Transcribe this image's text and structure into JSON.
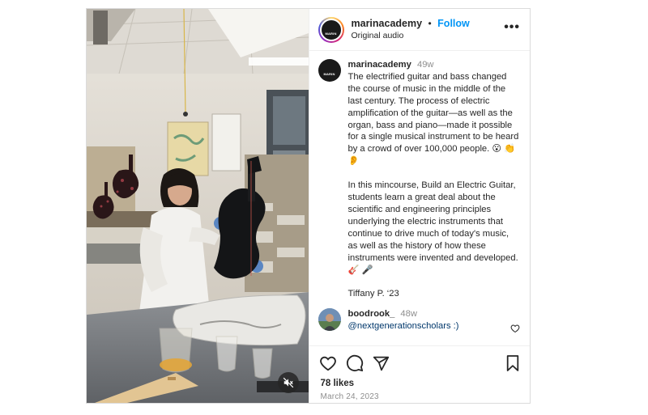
{
  "header": {
    "username": "marinacademy",
    "separator": "•",
    "follow_label": "Follow",
    "audio": "Original audio",
    "more_label": "•••",
    "avatar_text": "MARIN"
  },
  "caption": {
    "username": "marinacademy",
    "time": "49w",
    "paragraph1": "The electrified guitar and bass changed the course of music in the middle of the last century.  The process of electric amplification of the guitar—as well as the organ, bass and piano—made it possible for a single musical instrument to be heard by a crowd of over 100,000 people.  😮 👏 👂",
    "paragraph2": "In this mincourse, Build an Electric Guitar, students learn a great deal about the scientific and engineering principles underlying the electric instruments that continue to drive much of today's music, as well as the history of how these instruments were invented and developed. 🎸 🎤",
    "signature": "Tiffany P. ‘23"
  },
  "comment": {
    "username": "boodrook_",
    "time": "48w",
    "text": "@nextgenerationscholars :)"
  },
  "footer": {
    "likes": "78 likes",
    "date": "March 24, 2023"
  },
  "icons": {
    "like": "heart-icon",
    "comment": "comment-icon",
    "share": "send-icon",
    "save": "bookmark-icon",
    "mute": "speaker-muted-icon",
    "more": "more-icon"
  },
  "colors": {
    "link_blue": "#0095f6",
    "mention": "#00376b",
    "muted_text": "#8e8e8e",
    "border": "#dbdbdb"
  }
}
